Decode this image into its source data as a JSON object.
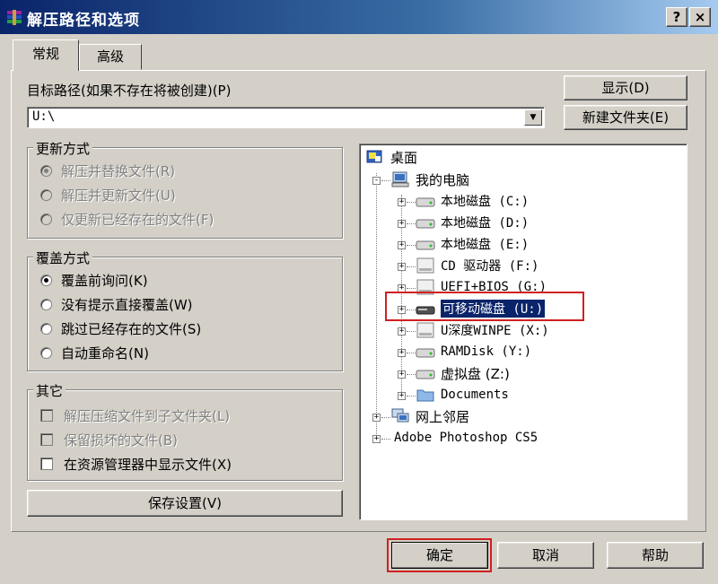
{
  "window": {
    "title": "解压路径和选项",
    "help_btn": "?",
    "close_btn": "×"
  },
  "tabs": [
    {
      "label": "常规"
    },
    {
      "label": "高级"
    }
  ],
  "dest": {
    "label": "目标路径(如果不存在将被创建)(P)",
    "value": "U:\\",
    "show_button": "显示(D)",
    "new_folder_button": "新建文件夹(E)"
  },
  "update_mode": {
    "title": "更新方式",
    "options": [
      {
        "label": "解压并替换文件(R)",
        "selected": true
      },
      {
        "label": "解压并更新文件(U)",
        "selected": false
      },
      {
        "label": "仅更新已经存在的文件(F)",
        "selected": false
      }
    ]
  },
  "overwrite_mode": {
    "title": "覆盖方式",
    "options": [
      {
        "label": "覆盖前询问(K)",
        "selected": true
      },
      {
        "label": "没有提示直接覆盖(W)",
        "selected": false
      },
      {
        "label": "跳过已经存在的文件(S)",
        "selected": false
      },
      {
        "label": "自动重命名(N)",
        "selected": false
      }
    ]
  },
  "misc": {
    "title": "其它",
    "options": [
      {
        "label": "解压压缩文件到子文件夹(L)",
        "enabled": false
      },
      {
        "label": "保留损坏的文件(B)",
        "enabled": false
      },
      {
        "label": "在资源管理器中显示文件(X)",
        "enabled": true
      }
    ]
  },
  "save_button": "保存设置(V)",
  "tree": {
    "root": "桌面",
    "computer": "我的电脑",
    "drives": [
      {
        "label": "本地磁盘 (C:)",
        "icon": "hard-disk-icon"
      },
      {
        "label": "本地磁盘 (D:)",
        "icon": "hard-disk-icon"
      },
      {
        "label": "本地磁盘 (E:)",
        "icon": "hard-disk-icon"
      },
      {
        "label": "CD 驱动器 (F:)",
        "icon": "cd-drive-icon"
      },
      {
        "label": "UEFI+BIOS (G:)",
        "icon": "cd-drive-icon"
      },
      {
        "label": "可移动磁盘 (U:)",
        "icon": "removable-disk-icon",
        "selected": true
      },
      {
        "label": "U深度WINPE (X:)",
        "icon": "cd-drive-icon"
      },
      {
        "label": "RAMDisk (Y:)",
        "icon": "hard-disk-icon"
      },
      {
        "label": "虚拟盘 (Z:)",
        "icon": "hard-disk-icon"
      },
      {
        "label": "Documents",
        "icon": "folder-icon"
      }
    ],
    "network": "网上邻居",
    "photoshop": "Adobe Photoshop CS5"
  },
  "footer": {
    "ok": "确定",
    "cancel": "取消",
    "help": "帮助"
  },
  "colors": {
    "highlight": "#d02020",
    "selection": "#0a246a",
    "face": "#d4d0c8"
  }
}
